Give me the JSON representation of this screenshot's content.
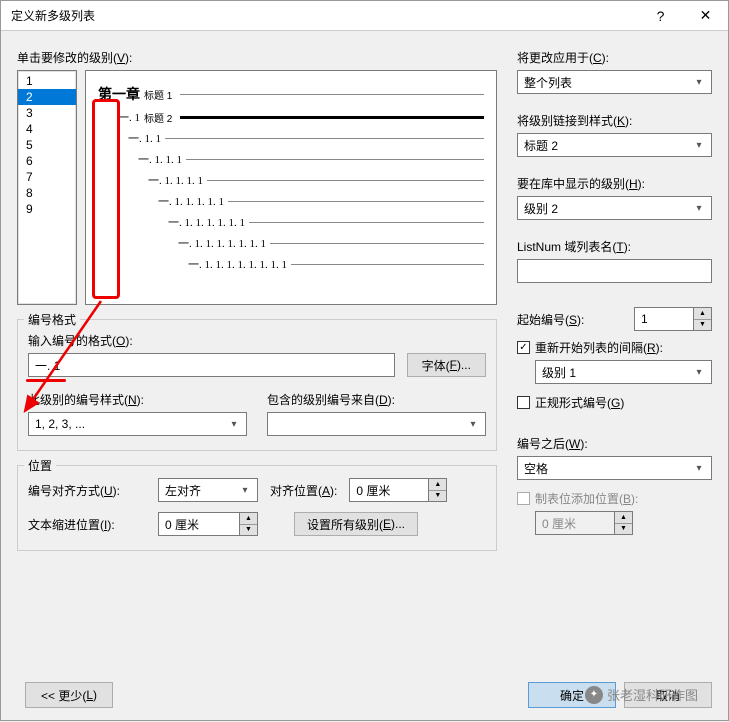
{
  "title": "定义新多级列表",
  "section_levels_label": "单击要修改的级别(",
  "section_levels_hotkey": "V",
  "levels": [
    "1",
    "2",
    "3",
    "4",
    "5",
    "6",
    "7",
    "8",
    "9"
  ],
  "selected_level_index": 1,
  "preview": [
    {
      "indent": 0,
      "num": "第一章",
      "label": "标题 1",
      "bold": true
    },
    {
      "indent": 20,
      "num": "一. 1",
      "label": "标题 2",
      "sel": true
    },
    {
      "indent": 30,
      "num": "一. 1. 1"
    },
    {
      "indent": 40,
      "num": "一. 1. 1. 1"
    },
    {
      "indent": 50,
      "num": "一. 1. 1. 1. 1"
    },
    {
      "indent": 60,
      "num": "一. 1. 1. 1. 1. 1"
    },
    {
      "indent": 70,
      "num": "一. 1. 1. 1. 1. 1. 1"
    },
    {
      "indent": 80,
      "num": "一. 1. 1. 1. 1. 1. 1. 1"
    },
    {
      "indent": 90,
      "num": "一. 1. 1. 1. 1. 1. 1. 1. 1"
    }
  ],
  "format_group": "编号格式",
  "format_label": "输入编号的格式(",
  "format_hotkey": "O",
  "format_value": "一. 1",
  "font_btn": "字体(",
  "font_hotkey": "F",
  "style_label": "此级别的编号样式(",
  "style_hotkey": "N",
  "style_value": "1, 2, 3, ...",
  "include_label": "包含的级别编号来自(",
  "include_hotkey": "D",
  "include_value": "",
  "position_group": "位置",
  "align_label": "编号对齐方式(",
  "align_hotkey": "U",
  "align_value": "左对齐",
  "alignat_label": "对齐位置(",
  "alignat_hotkey": "A",
  "alignat_value": "0 厘米",
  "indent_label": "文本缩进位置(",
  "indent_hotkey": "I",
  "indent_value": "0 厘米",
  "setall_btn": "设置所有级别(",
  "setall_hotkey": "E",
  "right": {
    "apply_label": "将更改应用于(",
    "apply_hotkey": "C",
    "apply_value": "整个列表",
    "link_label": "将级别链接到样式(",
    "link_hotkey": "K",
    "link_value": "标题 2",
    "gallery_label": "要在库中显示的级别(",
    "gallery_hotkey": "H",
    "gallery_value": "级别 2",
    "listnum_label": "ListNum 域列表名(",
    "listnum_hotkey": "T",
    "listnum_value": "",
    "start_label": "起始编号(",
    "start_hotkey": "S",
    "start_value": "1",
    "restart_label": "重新开始列表的间隔(",
    "restart_hotkey": "R",
    "restart_checked": true,
    "restart_value": "级别 1",
    "legal_label": "正规形式编号(",
    "legal_hotkey": "G",
    "follow_label": "编号之后(",
    "follow_hotkey": "W",
    "follow_value": "空格",
    "tab_label": "制表位添加位置(",
    "tab_hotkey": "B",
    "tab_value": "0 厘米"
  },
  "less_btn": "<< 更少(",
  "less_hotkey": "L",
  "ok_btn": "确定",
  "cancel_btn": "取消",
  "watermark": "张老湿科研作图"
}
